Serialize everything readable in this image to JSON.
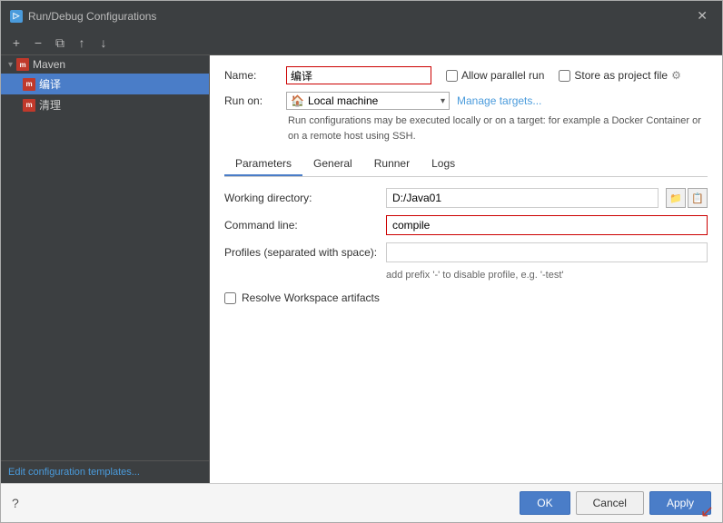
{
  "window": {
    "title": "Run/Debug Configurations",
    "close_btn": "✕"
  },
  "toolbar": {
    "add_btn": "+",
    "remove_btn": "−",
    "copy_btn": "⧉",
    "move_up_btn": "↑",
    "move_down_btn": "↓"
  },
  "sidebar": {
    "group_label": "Maven",
    "items": [
      {
        "label": "编译",
        "active": true
      },
      {
        "label": "清理",
        "active": false
      }
    ],
    "footer_link": "Edit configuration templates..."
  },
  "form": {
    "name_label": "Name:",
    "name_value": "编译",
    "allow_parallel_label": "Allow parallel run",
    "store_as_project_label": "Store as project file",
    "run_on_label": "Run on:",
    "run_on_value": "Local machine",
    "manage_targets_link": "Manage targets...",
    "description": "Run configurations may be executed locally or on a target: for example a Docker Container or on a remote host using SSH."
  },
  "tabs": [
    {
      "label": "Parameters",
      "active": true
    },
    {
      "label": "General",
      "active": false
    },
    {
      "label": "Runner",
      "active": false
    },
    {
      "label": "Logs",
      "active": false
    }
  ],
  "parameters": {
    "working_directory_label": "Working directory:",
    "working_directory_value": "D:/Java01",
    "command_line_label": "Command line:",
    "command_line_value": "compile",
    "profiles_label": "Profiles (separated with space):",
    "profiles_value": "",
    "profiles_hint": "add prefix '-' to disable profile, e.g. '-test'",
    "resolve_workspace_label": "Resolve Workspace artifacts"
  },
  "footer": {
    "help_icon": "?",
    "ok_label": "OK",
    "cancel_label": "Cancel",
    "apply_label": "Apply"
  }
}
